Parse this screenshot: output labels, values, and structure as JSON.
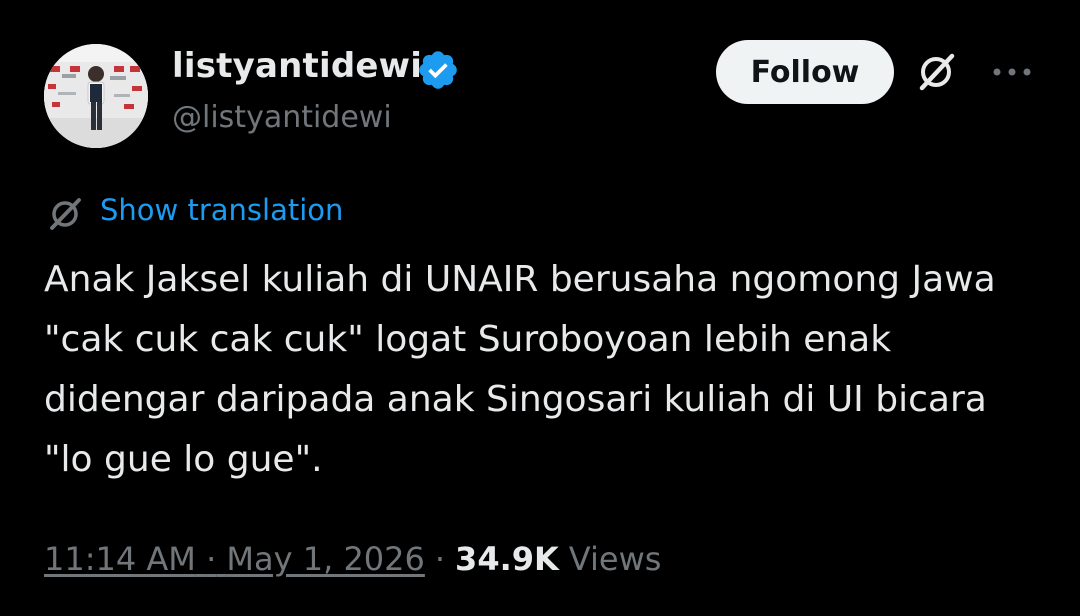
{
  "author": {
    "display_name": "listyantidewi",
    "handle": "@listyantidewi",
    "verified": true
  },
  "actions": {
    "follow_label": "Follow",
    "grok_icon": "grok-icon",
    "more_icon": "more-icon"
  },
  "translation": {
    "icon": "translate-icon",
    "label": "Show translation"
  },
  "tweet": {
    "text": "Anak Jaksel kuliah di UNAIR berusaha ngomong Jawa \"cak cuk cak cuk\" logat Suroboyoan lebih enak didengar daripada anak Singosari kuliah di UI bicara \"lo gue lo gue\"."
  },
  "meta": {
    "time": "11:14 AM",
    "date_separator": "·",
    "date": "May 1, 2026",
    "views_separator": "·",
    "views_count": "34.9K",
    "views_label": "Views"
  },
  "colors": {
    "background": "#000000",
    "primary_text": "#e7e9ea",
    "secondary_text": "#71767b",
    "link": "#1d9bf0",
    "verified": "#1d9bf0",
    "follow_bg": "#eff3f4"
  }
}
